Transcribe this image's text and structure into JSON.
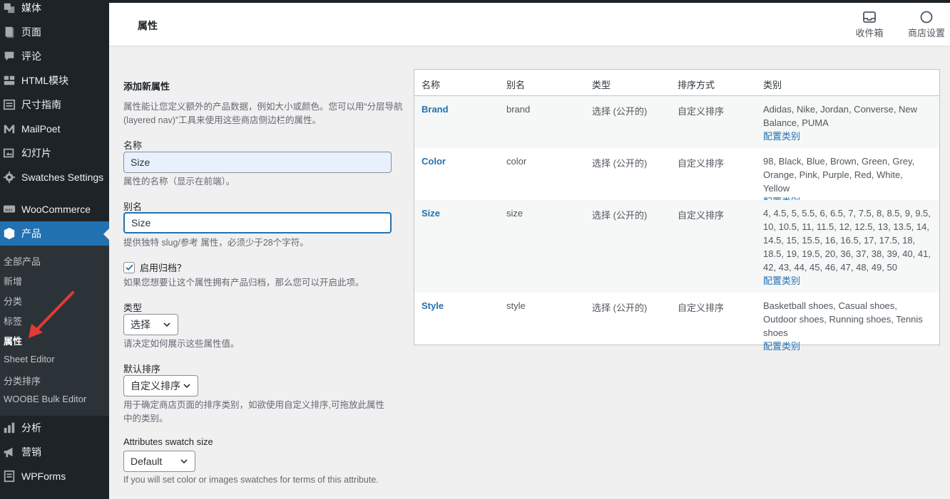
{
  "sidebar": {
    "items": [
      {
        "label": "媒体",
        "icon": "media-icon"
      },
      {
        "label": "页面",
        "icon": "page-icon"
      },
      {
        "label": "评论",
        "icon": "comment-icon"
      },
      {
        "label": "HTML模块",
        "icon": "html-block-icon"
      },
      {
        "label": "尺寸指南",
        "icon": "size-guide-icon"
      },
      {
        "label": "MailPoet",
        "icon": "mailpoet-icon"
      },
      {
        "label": "幻灯片",
        "icon": "slides-icon"
      },
      {
        "label": "Swatches Settings",
        "icon": "gear-icon"
      },
      {
        "label": "WooCommerce",
        "icon": "woo-icon"
      },
      {
        "label": "产品",
        "icon": "product-icon"
      },
      {
        "label": "分析",
        "icon": "analytics-icon"
      },
      {
        "label": "营销",
        "icon": "megaphone-icon"
      },
      {
        "label": "WPForms",
        "icon": "wpforms-icon"
      }
    ],
    "submenu": [
      "全部产品",
      "新增",
      "分类",
      "标签",
      "属性",
      "Sheet Editor",
      "分类排序",
      "WOOBE Bulk Editor"
    ]
  },
  "header": {
    "title": "属性",
    "inbox_label": "收件箱",
    "store_settings_label": "商店设置"
  },
  "form": {
    "heading": "添加新属性",
    "intro": "属性能让您定义额外的产品数据，例如大小或颜色。您可以用“分层导航(layered nav)”工具来使用这些商店侧边栏的属性。",
    "name_label": "名称",
    "name_value": "Size",
    "name_help": "属性的名称（显示在前端）。",
    "slug_label": "别名",
    "slug_value": "Size",
    "slug_help": "提供独特 slug/参考 属性，必须少于28个字符。",
    "archive_label": "启用归档？",
    "archive_checked": true,
    "archive_help": "如果您想要让这个属性拥有产品归档，那么您可以开启此项。",
    "type_label": "类型",
    "type_value": "选择",
    "type_help": "请决定如何展示这些属性值。",
    "order_label": "默认排序",
    "order_value": "自定义排序",
    "order_help": "用于确定商店页面的排序类别，如欲使用自定义排序,可拖放此属性中的类别。",
    "swatch_label": "Attributes swatch size",
    "swatch_value": "Default",
    "swatch_help": "If you will set color or images swatches for terms of this attribute."
  },
  "table": {
    "headers": [
      "名称",
      "别名",
      "类型",
      "排序方式",
      "类别"
    ],
    "configure_label": "配置类别",
    "rows": [
      {
        "name": "Brand",
        "slug": "brand",
        "type": "选择 (公开的)",
        "order": "自定义排序",
        "terms": "Adidas, Nike, Jordan, Converse, New Balance, PUMA"
      },
      {
        "name": "Color",
        "slug": "color",
        "type": "选择 (公开的)",
        "order": "自定义排序",
        "terms": "98, Black, Blue, Brown, Green, Grey, Orange, Pink, Purple, Red, White, Yellow"
      },
      {
        "name": "Size",
        "slug": "size",
        "type": "选择 (公开的)",
        "order": "自定义排序",
        "terms": "4, 4.5, 5, 5.5, 6, 6.5, 7, 7.5, 8, 8.5, 9, 9.5, 10, 10.5, 11, 11.5, 12, 12.5, 13, 13.5, 14, 14.5, 15, 15.5, 16, 16.5, 17, 17.5, 18, 18.5, 19, 19.5, 20, 36, 37, 38, 39, 40, 41, 42, 43, 44, 45, 46, 47, 48, 49, 50"
      },
      {
        "name": "Style",
        "slug": "style",
        "type": "选择 (公开的)",
        "order": "自定义排序",
        "terms": "Basketball shoes, Casual shoes, Outdoor shoes, Running shoes, Tennis shoes"
      }
    ]
  },
  "colors": {
    "sidebar_bg": "#1d2327",
    "accent": "#2271b1",
    "annotation_arrow": "#e53935"
  }
}
